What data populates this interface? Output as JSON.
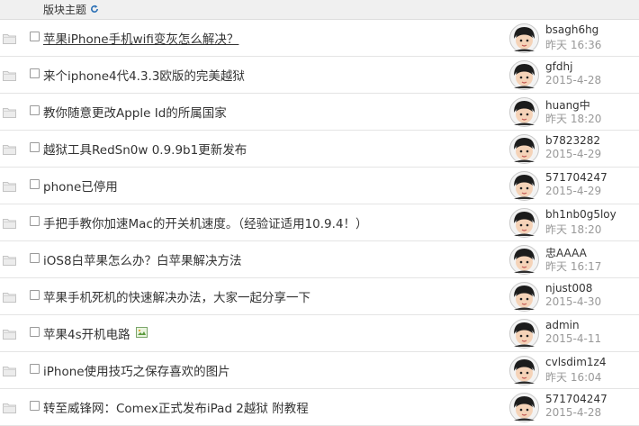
{
  "header": {
    "title": "版块主题"
  },
  "threads": [
    {
      "title": "苹果iPhone手机wifi变灰怎么解决？",
      "author": "bsagh6hg",
      "time": "昨天 16:36",
      "underlined": true,
      "image": false
    },
    {
      "title": "来个iphone4代4.3.3欧版的完美越狱",
      "author": "gfdhj",
      "time": "2015-4-28",
      "underlined": false,
      "image": false
    },
    {
      "title": "教你随意更改Apple Id的所属国家",
      "author": "huang中",
      "time": "昨天 18:20",
      "underlined": false,
      "image": false
    },
    {
      "title": "越狱工具RedSn0w 0.9.9b1更新发布",
      "author": "b7823282",
      "time": "2015-4-29",
      "underlined": false,
      "image": false
    },
    {
      "title": "phone已停用",
      "author": "571704247",
      "time": "2015-4-29",
      "underlined": false,
      "image": false
    },
    {
      "title": "手把手教你加速Mac的开关机速度。（经验证适用10.9.4！）",
      "author": "bh1nb0g5loy",
      "time": "昨天 18:20",
      "underlined": false,
      "image": false
    },
    {
      "title": "iOS8白苹果怎么办？白苹果解决方法",
      "author": "忠AAAA",
      "time": "昨天 16:17",
      "underlined": false,
      "image": false
    },
    {
      "title": "苹果手机死机的快速解决办法，大家一起分享一下",
      "author": "njust008",
      "time": "2015-4-30",
      "underlined": false,
      "image": false
    },
    {
      "title": "苹果4s开机电路",
      "author": "admin",
      "time": "2015-4-11",
      "underlined": false,
      "image": true
    },
    {
      "title": "iPhone使用技巧之保存喜欢的图片",
      "author": "cvlsdim1z4",
      "time": "昨天 16:04",
      "underlined": false,
      "image": false
    },
    {
      "title": "转至威锋网：Comex正式发布iPad 2越狱 附教程",
      "author": "571704247",
      "time": "2015-4-28",
      "underlined": false,
      "image": false
    }
  ]
}
